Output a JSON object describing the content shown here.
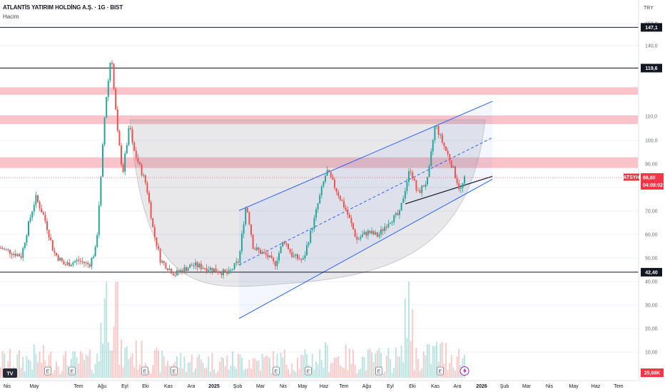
{
  "header": {
    "title": "ATLANTİS YATIRIM HOLDİNG A.Ş. · 1G · BIST",
    "volume_label": "Hacim",
    "currency": "TRY"
  },
  "colors": {
    "up": "#26a69a",
    "down": "#ef5350",
    "zone": "#f7a9b2",
    "channel": "#2962ff",
    "level": "#131722",
    "price_tag": "#f23645"
  },
  "chart_data": {
    "type": "candlestick",
    "symbol": "ATSYH",
    "y_scale": "log",
    "ylim": [
      34,
      154
    ],
    "y_ticks": [
      "150,0",
      "140,0",
      "130,0",
      "110,0",
      "100,0",
      "90,00",
      "80,00",
      "70,00",
      "60,00",
      "50,00",
      "40,00",
      "30,00",
      "20,00",
      "10,00"
    ],
    "x_ticks": [
      "Nis",
      "May",
      "Tem",
      "Ağu",
      "Eyl",
      "Eki",
      "Kas",
      "Ara",
      "2025",
      "Şub",
      "Mar",
      "Nis",
      "May",
      "Haz",
      "Tem",
      "Ağu",
      "Eyl",
      "Eki",
      "Kas",
      "Ara",
      "2026",
      "Şub",
      "Mar",
      "Nis",
      "May",
      "Haz",
      "Tem"
    ],
    "price_anchors": [
      [
        0,
        48
      ],
      [
        30,
        46
      ],
      [
        50,
        62
      ],
      [
        62,
        56
      ],
      [
        75,
        47
      ],
      [
        90,
        44
      ],
      [
        110,
        45
      ],
      [
        125,
        44
      ],
      [
        135,
        48
      ],
      [
        142,
        70
      ],
      [
        148,
        100
      ],
      [
        152,
        113
      ],
      [
        156,
        130
      ],
      [
        160,
        105
      ],
      [
        165,
        85
      ],
      [
        172,
        70
      ],
      [
        182,
        90
      ],
      [
        186,
        80
      ],
      [
        195,
        73
      ],
      [
        205,
        66
      ],
      [
        215,
        52
      ],
      [
        225,
        45
      ],
      [
        245,
        42
      ],
      [
        270,
        44
      ],
      [
        300,
        43
      ],
      [
        320,
        42
      ],
      [
        335,
        45
      ],
      [
        345,
        60
      ],
      [
        355,
        48
      ],
      [
        375,
        46
      ],
      [
        385,
        44
      ],
      [
        398,
        50
      ],
      [
        410,
        46
      ],
      [
        425,
        45
      ],
      [
        440,
        55
      ],
      [
        458,
        71
      ],
      [
        470,
        65
      ],
      [
        485,
        58
      ],
      [
        500,
        50
      ],
      [
        515,
        52
      ],
      [
        530,
        51
      ],
      [
        545,
        55
      ],
      [
        560,
        57
      ],
      [
        575,
        72
      ],
      [
        585,
        63
      ],
      [
        600,
        68
      ],
      [
        610,
        90
      ],
      [
        620,
        82
      ],
      [
        632,
        74
      ],
      [
        645,
        64
      ],
      [
        652,
        68.6
      ]
    ],
    "horizontal_levels": [
      {
        "label": "147,1",
        "value": 147.1
      },
      {
        "label": "119,6",
        "value": 119.6
      },
      {
        "label": "42,40",
        "value": 42.4
      }
    ],
    "resistance_zones": [
      [
        104.5,
        108.5
      ],
      [
        90,
        94
      ],
      [
        72,
        76
      ]
    ],
    "channel": {
      "upper": [
        [
          335,
          58
        ],
        [
          690,
          101
        ]
      ],
      "middle": [
        [
          335,
          44
        ],
        [
          690,
          84
        ]
      ],
      "lower": [
        [
          335,
          33.5
        ],
        [
          690,
          68
        ]
      ]
    },
    "support_line": [
      [
        568,
        60
      ],
      [
        690,
        69
      ]
    ],
    "cup_pattern": {
      "left": [
        182,
        92
      ],
      "bottom": [
        400,
        40
      ],
      "right": [
        680,
        92
      ]
    },
    "last_price": {
      "label": "68,60",
      "value": 68.6,
      "symbol": "ATSYH",
      "countdown": "04:08:02"
    },
    "volume": {
      "last_label": "25,98K"
    },
    "events": [
      "E",
      "E",
      "E",
      "E",
      "E",
      "E",
      "E",
      "E",
      "E"
    ],
    "watermark": "TradingView"
  }
}
